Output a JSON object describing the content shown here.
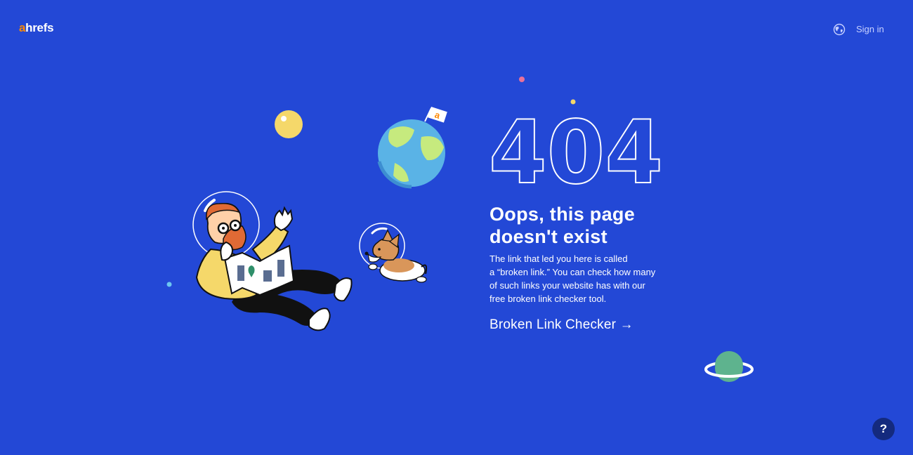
{
  "header": {
    "logo": {
      "accent": "a",
      "rest": "hrefs",
      "accent_color": "#ff8800"
    },
    "language_icon": "globe-icon",
    "signin_label": "Sign in"
  },
  "error": {
    "code": "404",
    "title_line1": "Oops, this page",
    "title_line2": "doesn't exist",
    "description_lines": [
      "The link that led you here is called",
      "a “broken link.” You can check how many",
      "of such links your website has with our",
      "free broken link checker tool."
    ],
    "cta_label": "Broken Link Checker →"
  },
  "help": {
    "label": "?",
    "icon": "question-icon"
  },
  "flag_letter": "a",
  "colors": {
    "background": "#2348d6",
    "accent": "#ff8800",
    "help_button": "#142a7e",
    "planet_green": "#5eb38e",
    "moon_yellow": "#f5d86a",
    "earth_blue": "#5ab3e6"
  }
}
